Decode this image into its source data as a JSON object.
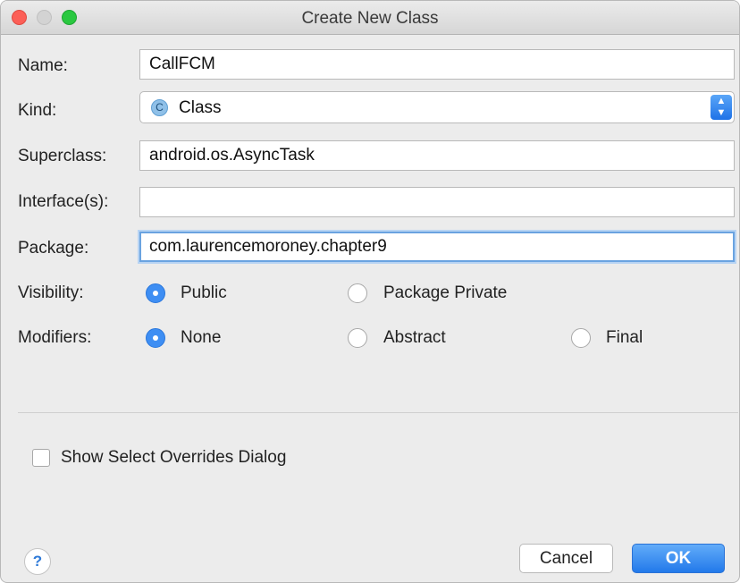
{
  "window": {
    "title": "Create New Class"
  },
  "labels": {
    "name": "Name:",
    "kind": "Kind:",
    "superclass": "Superclass:",
    "interfaces": "Interface(s):",
    "package": "Package:",
    "visibility": "Visibility:",
    "modifiers": "Modifiers:"
  },
  "fields": {
    "name": "CallFCM",
    "kind": "Class",
    "kind_icon": "C",
    "superclass": "android.os.AsyncTask",
    "interfaces": "",
    "package": "com.laurencemoroney.chapter9"
  },
  "visibility": {
    "options": [
      {
        "label": "Public",
        "selected": true
      },
      {
        "label": "Package Private",
        "selected": false
      }
    ]
  },
  "modifiers": {
    "options": [
      {
        "label": "None",
        "selected": true
      },
      {
        "label": "Abstract",
        "selected": false
      },
      {
        "label": "Final",
        "selected": false
      }
    ]
  },
  "checkbox": {
    "label": "Show Select Overrides Dialog",
    "checked": false
  },
  "buttons": {
    "help": "?",
    "cancel": "Cancel",
    "ok": "OK"
  },
  "colors": {
    "accent": "#3e8ef3",
    "close": "#fc5f57",
    "maximize": "#2ac840"
  }
}
